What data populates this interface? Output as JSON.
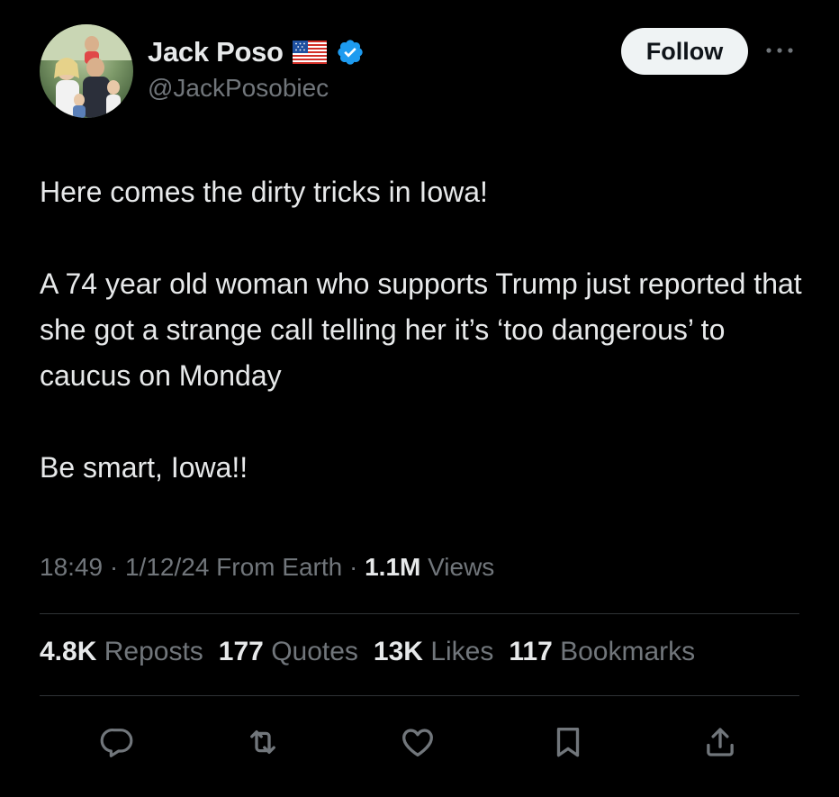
{
  "author": {
    "display_name": "Jack Poso",
    "handle": "@JackPosobiec",
    "flag_icon": "us-flag-icon",
    "verified_icon": "verified-badge-icon",
    "verified_color": "#1d9bf0"
  },
  "follow_button": {
    "label": "Follow"
  },
  "more_icon": "more-horizontal-icon",
  "tweet": {
    "paragraphs": [
      "Here comes the dirty tricks in Iowa!",
      "A 74 year old woman who supports Trump just reported that she got a strange call telling her it’s ‘too dangerous’ to caucus on Monday",
      "Be smart, Iowa!!"
    ]
  },
  "meta": {
    "time": "18:49",
    "separator": " · ",
    "date": "1/12/24",
    "source": "From Earth",
    "views_count": "1.1M",
    "views_label": "Views"
  },
  "stats": {
    "reposts": {
      "count": "4.8K",
      "label": "Reposts"
    },
    "quotes": {
      "count": "177",
      "label": "Quotes"
    },
    "likes": {
      "count": "13K",
      "label": "Likes"
    },
    "bookmarks": {
      "count": "117",
      "label": "Bookmarks"
    }
  },
  "actions": [
    {
      "name": "reply",
      "icon": "reply-icon"
    },
    {
      "name": "repost",
      "icon": "repost-icon"
    },
    {
      "name": "like",
      "icon": "heart-icon"
    },
    {
      "name": "bookmark",
      "icon": "bookmark-icon"
    },
    {
      "name": "share",
      "icon": "share-icon"
    }
  ],
  "colors": {
    "background": "#000000",
    "primary_text": "#e7e9ea",
    "secondary_text": "#71767b",
    "divider": "#2f3336",
    "follow_button_bg": "#eff3f4",
    "action_icon": "#71767b"
  }
}
